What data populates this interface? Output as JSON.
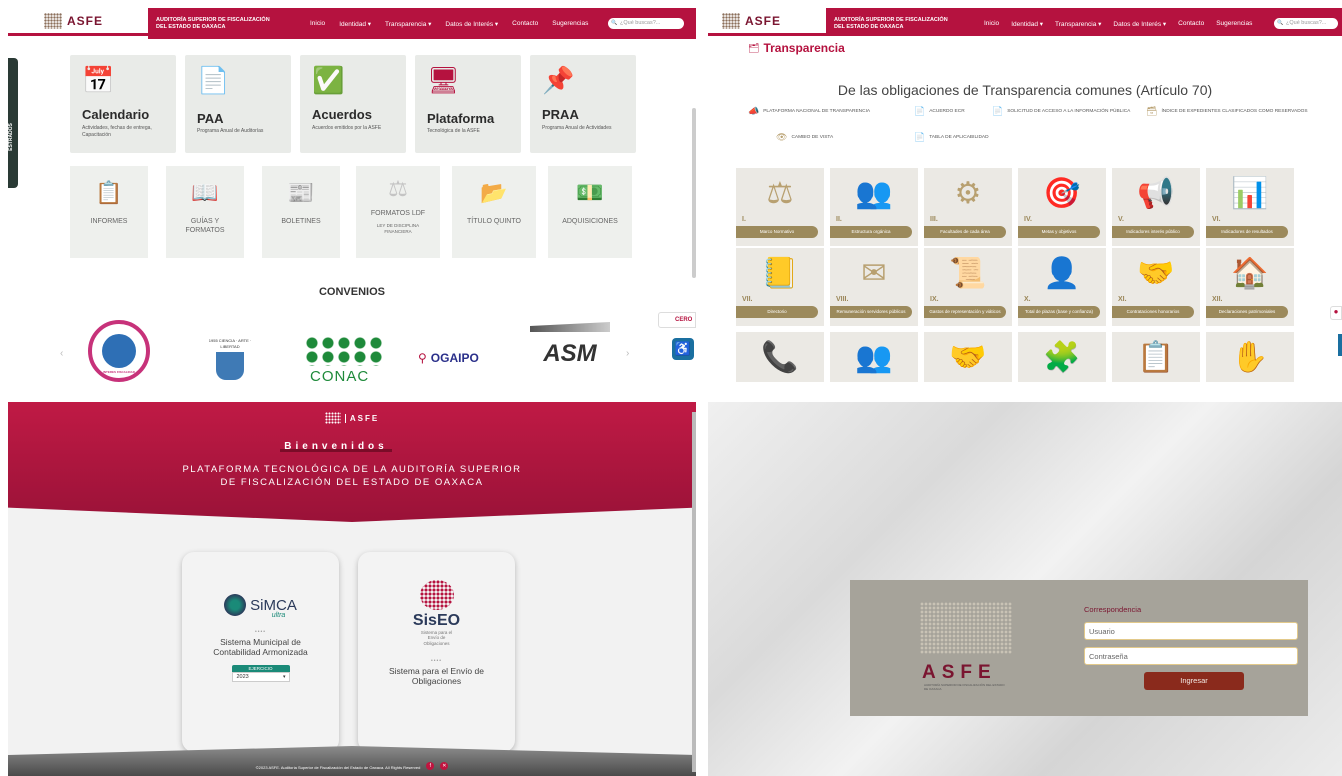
{
  "nav": {
    "abbr": "ASFE",
    "org": "AUDITORÍA SUPERIOR DE FISCALIZACIÓN DEL ESTADO DE OAXACA",
    "menu": [
      "Inicio",
      "Identidad ▾",
      "Transparencia ▾",
      "Datos de Interés ▾",
      "Contacto",
      "Sugerencias"
    ],
    "search_placeholder": "¿Qué buscas?...",
    "search_placeholder_short": "¿Qué buscas?..."
  },
  "home": {
    "side_tab": "ESTRADOS",
    "cards": [
      {
        "icon": "calendar-icon",
        "glyph": "📅",
        "title": "Calendario",
        "sub": "Actividades, fechas de entrega, Capacitación"
      },
      {
        "icon": "document-chart-icon",
        "glyph": "📄",
        "title": "PAA",
        "sub": "Programa Anual de Auditorías"
      },
      {
        "icon": "check-badge-icon",
        "glyph": "✅",
        "title": "Acuerdos",
        "sub": "Acuerdos emitidos por la ASFE"
      },
      {
        "icon": "monitor-gear-icon",
        "glyph": "🖥",
        "title": "Plataforma",
        "sub": "Tecnológica de la ASFE"
      },
      {
        "icon": "pin-icon",
        "glyph": "📌",
        "title": "PRAA",
        "sub": "Programa Anual de Actividades"
      }
    ],
    "gray_cards": [
      {
        "icon": "report-icon",
        "glyph": "📋",
        "title": "INFORMES",
        "sub": ""
      },
      {
        "icon": "book-icon",
        "glyph": "📖",
        "title": "GUÍAS Y FORMATOS",
        "sub": ""
      },
      {
        "icon": "newspaper-icon",
        "glyph": "📰",
        "title": "BOLETINES",
        "sub": ""
      },
      {
        "icon": "scales-document-icon",
        "glyph": "⚖",
        "title": "FORMATOS LDF",
        "sub": "LEY DE DISCIPLINA FINANCIERA"
      },
      {
        "icon": "folder-money-icon",
        "glyph": "📂",
        "title": "TÍTULO QUINTO",
        "sub": ""
      },
      {
        "icon": "hand-money-icon",
        "glyph": "💵",
        "title": "ADQUISICIONES",
        "sub": ""
      }
    ],
    "convenios_title": "CONVENIOS",
    "logos": [
      "INTERES FISCALIDAD",
      "1955 CIENCIA · ARTE · LIBERTAD",
      "CONAC",
      "OGAIPO",
      "ASM"
    ],
    "badge_cero": "CERO"
  },
  "transparencia": {
    "title": "Transparencia",
    "heading": "De las obligaciones de Transparencia comunes (Artículo 70)",
    "links": [
      "PLATAFORMA NACIONAL DE TRANSPARENCIA",
      "ACUERDO ECR",
      "SOLICITUD DE ACCESO A LA INFORMACIÓN PÚBLICA",
      "ÍNDICE DE EXPEDIENTES CLASIFICADOS COMO RESERVADOS",
      "CAMBIO DE VISTA",
      "TABLA DE APLICABILIDAD"
    ],
    "tiles": [
      {
        "n": "I.",
        "label": "Marco Normativo",
        "glyph": "⚖"
      },
      {
        "n": "II.",
        "label": "Estructura orgánica",
        "glyph": "👥"
      },
      {
        "n": "III.",
        "label": "Facultades de cada área",
        "glyph": "⚙"
      },
      {
        "n": "IV.",
        "label": "Metas y objetivos",
        "glyph": "🎯"
      },
      {
        "n": "V.",
        "label": "Indicadores interés público",
        "glyph": "📢"
      },
      {
        "n": "VI.",
        "label": "Indicadores de resultados",
        "glyph": "📊"
      },
      {
        "n": "VII.",
        "label": "Directorio",
        "glyph": "📒"
      },
      {
        "n": "VIII.",
        "label": "Remuneración servidores públicos",
        "glyph": "✉"
      },
      {
        "n": "IX.",
        "label": "Gastos de representación y viáticos",
        "glyph": "📜"
      },
      {
        "n": "X.",
        "label": "Total de plazas (base y confianza)",
        "glyph": "👤"
      },
      {
        "n": "XI.",
        "label": "Contrataciones honorarios",
        "glyph": "🤝"
      },
      {
        "n": "XII.",
        "label": "Declaraciones patrimoniales",
        "glyph": "🏠"
      }
    ],
    "row3_glyphs": [
      "📞",
      "👥",
      "🤝",
      "🧩",
      "📋",
      "✋"
    ]
  },
  "plataforma": {
    "abbr": "ASFE",
    "welcome": "Bienvenidos",
    "title_line1": "PLATAFORMA TECNOLÓGICA DE LA AUDITORÍA SUPERIOR",
    "title_line2": "DE FISCALIZACIÓN DEL ESTADO DE OAXACA",
    "simca": {
      "brand": "SiMCA",
      "brand_sub": "ultra",
      "dots": "••••",
      "desc": "Sistema Municipal de Contabilidad Armonizada",
      "year_label": "EJERCICIO",
      "year": "2023"
    },
    "siseo": {
      "brand": "SisEO",
      "brand_sub": "Sistema para el Envío de Obligaciones",
      "dots": "••••",
      "desc": "Sistema para el Envío de Obligaciones"
    },
    "footer": "©2023 ASFE. Auditoría Superior de Fiscalización del Estado de Oaxaca. All Rights Reserved"
  },
  "login": {
    "abbr": "ASFE",
    "org": "AUDITORÍA SUPERIOR DE FISCALIZACIÓN DEL ESTADO DE OAXACA",
    "title": "Correspondencia",
    "user_placeholder": "Usuario",
    "pass_placeholder": "Contraseña",
    "submit": "Ingresar"
  },
  "colors": {
    "brand": "#b5123f",
    "gold": "#9c8a5c",
    "login_btn": "#8a2a1c"
  }
}
